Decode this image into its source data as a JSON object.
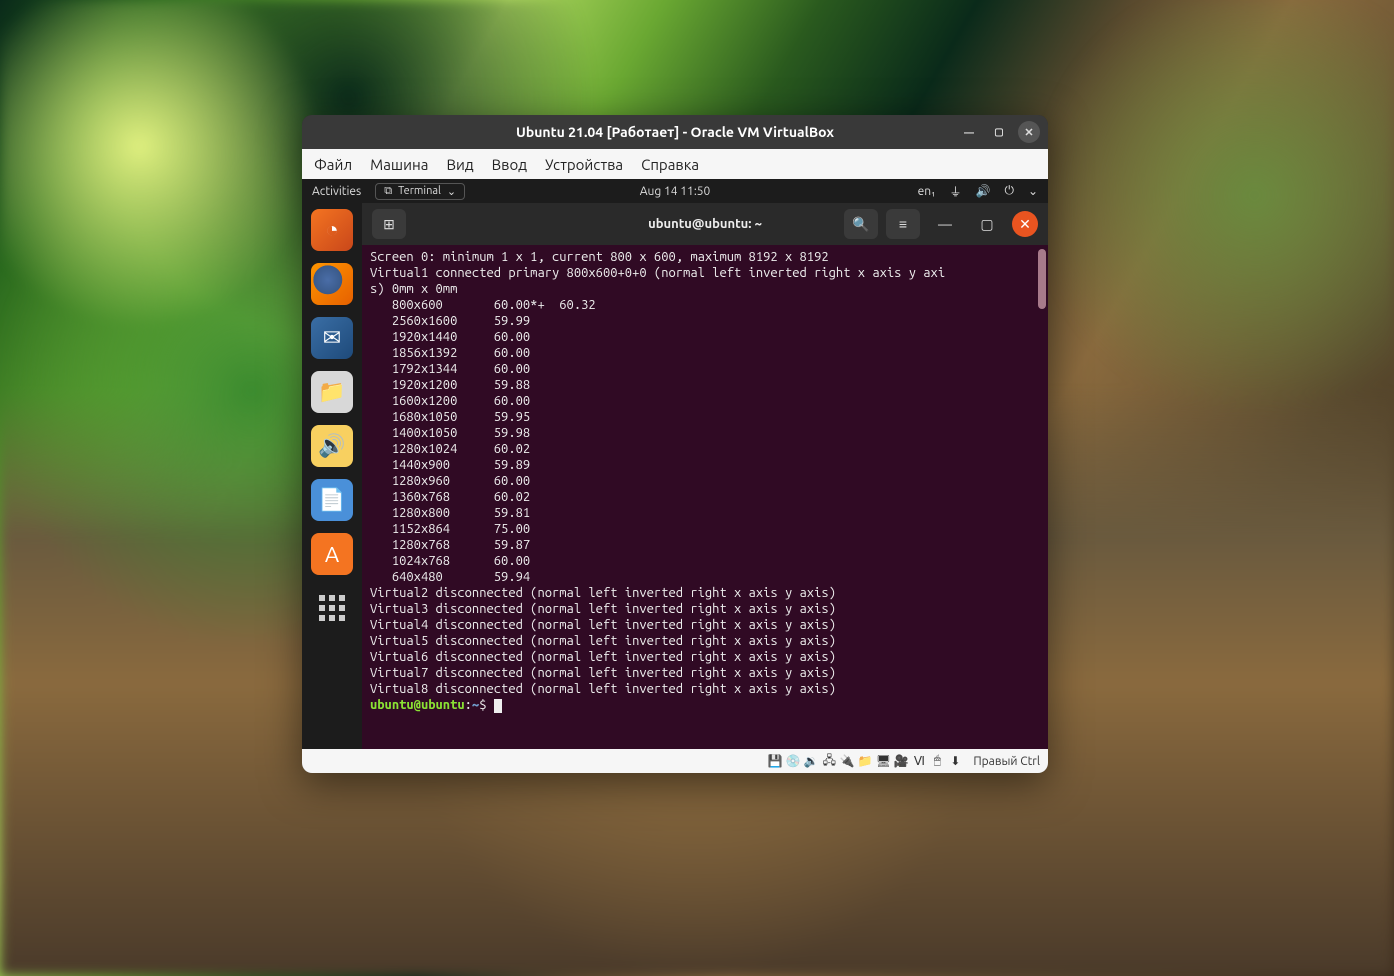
{
  "vbox": {
    "title": "Ubuntu 21.04 [Работает] - Oracle VM VirtualBox",
    "menu": [
      "Файл",
      "Машина",
      "Вид",
      "Ввод",
      "Устройства",
      "Справка"
    ],
    "host_key": "Правый Ctrl"
  },
  "gnome": {
    "activities": "Activities",
    "app_label": "Terminal",
    "clock": "Aug 14  11:50",
    "lang": "en₁"
  },
  "dock": {
    "items": [
      {
        "name": "disk-utility",
        "glyph": "◔"
      },
      {
        "name": "firefox",
        "glyph": ""
      },
      {
        "name": "thunderbird",
        "glyph": "✉"
      },
      {
        "name": "files",
        "glyph": "📁"
      },
      {
        "name": "rhythmbox",
        "glyph": "🔊"
      },
      {
        "name": "libreoffice",
        "glyph": "📄"
      },
      {
        "name": "software",
        "glyph": "A"
      },
      {
        "name": "show-apps",
        "glyph": ""
      }
    ]
  },
  "term_header": {
    "title": "ubuntu@ubuntu: ~"
  },
  "terminal": {
    "screen_line": "Screen 0: minimum 1 x 1, current 800 x 600, maximum 8192 x 8192",
    "virtual1_a": "Virtual1 connected primary 800x600+0+0 (normal left inverted right x axis y axi",
    "virtual1_b": "s) 0mm x 0mm",
    "modes": [
      {
        "res": "800x600",
        "rate": "60.00*+  60.32"
      },
      {
        "res": "2560x1600",
        "rate": "59.99"
      },
      {
        "res": "1920x1440",
        "rate": "60.00"
      },
      {
        "res": "1856x1392",
        "rate": "60.00"
      },
      {
        "res": "1792x1344",
        "rate": "60.00"
      },
      {
        "res": "1920x1200",
        "rate": "59.88"
      },
      {
        "res": "1600x1200",
        "rate": "60.00"
      },
      {
        "res": "1680x1050",
        "rate": "59.95"
      },
      {
        "res": "1400x1050",
        "rate": "59.98"
      },
      {
        "res": "1280x1024",
        "rate": "60.02"
      },
      {
        "res": "1440x900",
        "rate": "59.89"
      },
      {
        "res": "1280x960",
        "rate": "60.00"
      },
      {
        "res": "1360x768",
        "rate": "60.02"
      },
      {
        "res": "1280x800",
        "rate": "59.81"
      },
      {
        "res": "1152x864",
        "rate": "75.00"
      },
      {
        "res": "1280x768",
        "rate": "59.87"
      },
      {
        "res": "1024x768",
        "rate": "60.00"
      },
      {
        "res": "640x480",
        "rate": "59.94"
      }
    ],
    "disconnected": [
      "Virtual2 disconnected (normal left inverted right x axis y axis)",
      "Virtual3 disconnected (normal left inverted right x axis y axis)",
      "Virtual4 disconnected (normal left inverted right x axis y axis)",
      "Virtual5 disconnected (normal left inverted right x axis y axis)",
      "Virtual6 disconnected (normal left inverted right x axis y axis)",
      "Virtual7 disconnected (normal left inverted right x axis y axis)",
      "Virtual8 disconnected (normal left inverted right x axis y axis)"
    ],
    "prompt_user": "ubuntu@ubuntu",
    "prompt_path": "~",
    "prompt_sym": "$"
  }
}
